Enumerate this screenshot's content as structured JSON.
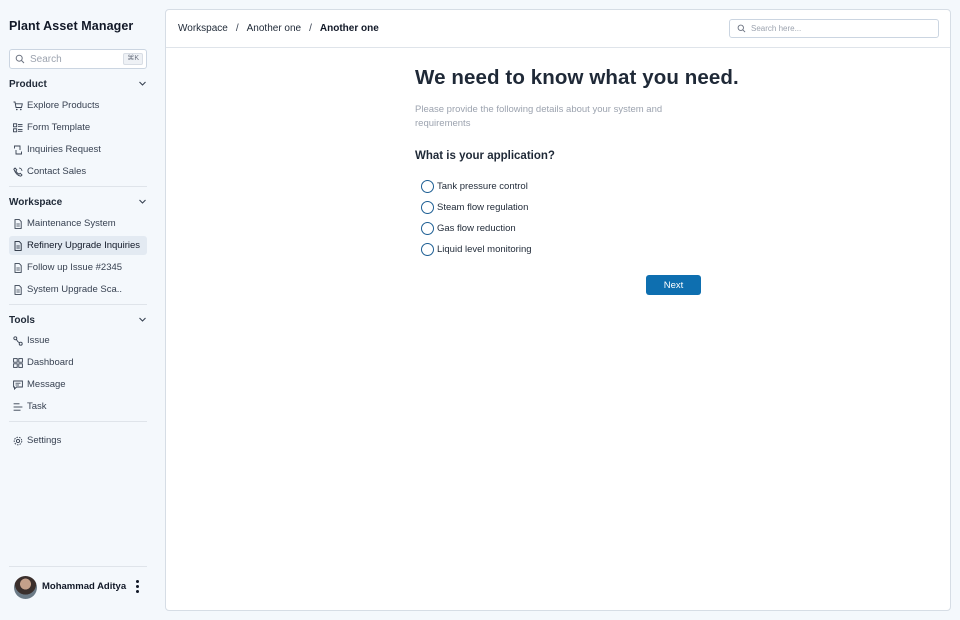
{
  "app": {
    "title": "Plant Asset Manager"
  },
  "sidebar": {
    "search": {
      "placeholder": "Search",
      "shortcut": "⌘K"
    },
    "sections": [
      {
        "title": "Product",
        "items": [
          {
            "label": "Explore Products",
            "icon": "cart-icon"
          },
          {
            "label": "Form Template",
            "icon": "layout-icon"
          },
          {
            "label": "Inquiries Request",
            "icon": "refresh-icon"
          },
          {
            "label": "Contact Sales",
            "icon": "phone-icon"
          }
        ]
      },
      {
        "title": "Workspace",
        "items": [
          {
            "label": "Maintenance System",
            "icon": "document-icon"
          },
          {
            "label": "Refinery Upgrade Inquiries",
            "icon": "document-icon",
            "active": true
          },
          {
            "label": "Follow up Issue #2345",
            "icon": "document-icon"
          },
          {
            "label": "System Upgrade Sca..",
            "icon": "document-icon"
          }
        ]
      },
      {
        "title": "Tools",
        "items": [
          {
            "label": "Issue",
            "icon": "link-icon"
          },
          {
            "label": "Dashboard",
            "icon": "grid-icon"
          },
          {
            "label": "Message",
            "icon": "chat-icon"
          },
          {
            "label": "Task",
            "icon": "list-icon"
          }
        ]
      }
    ],
    "settings": {
      "label": "Settings",
      "icon": "gear-icon"
    },
    "profile": {
      "name": "Mohammad Aditya"
    }
  },
  "topbar": {
    "breadcrumb": [
      "Workspace",
      "Another one",
      "Another one"
    ],
    "search_placeholder": "Search here..."
  },
  "form": {
    "headline": "We need to know what you need.",
    "subtext": "Please provide the following details about your system and requirements",
    "question": "What is your application?",
    "options": [
      "Tank pressure control",
      "Steam flow regulation",
      "Gas flow reduction",
      "Liquid level monitoring"
    ],
    "next_label": "Next"
  },
  "colors": {
    "accent": "#0e6fb0",
    "radio_border": "#1e5f94",
    "background": "#f4f8fc"
  }
}
